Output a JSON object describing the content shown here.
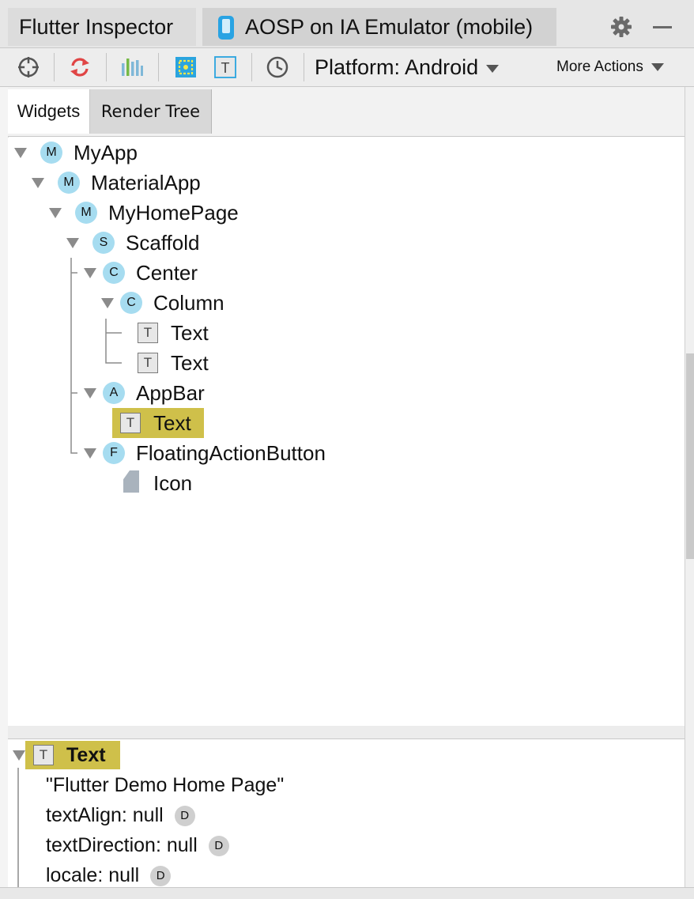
{
  "tabs": {
    "inspector": "Flutter Inspector",
    "emulator": "AOSP on IA Emulator (mobile)"
  },
  "toolbar": {
    "icons": [
      "target-icon",
      "refresh-icon",
      "performance-icon",
      "select-widget-icon",
      "text-icon",
      "clock-icon"
    ],
    "platform": "Platform: Android",
    "more_actions": "More Actions"
  },
  "subtabs": {
    "widgets": "Widgets",
    "render_tree": "Render Tree"
  },
  "tree": {
    "nodes": [
      {
        "label": "MyApp",
        "badge": "M"
      },
      {
        "label": "MaterialApp",
        "badge": "M"
      },
      {
        "label": "MyHomePage",
        "badge": "M"
      },
      {
        "label": "Scaffold",
        "badge": "S"
      },
      {
        "label": "Center",
        "badge": "C"
      },
      {
        "label": "Column",
        "badge": "C"
      },
      {
        "label": "Text",
        "badge": "T"
      },
      {
        "label": "Text",
        "badge": "T"
      },
      {
        "label": "AppBar",
        "badge": "A"
      },
      {
        "label": "Text",
        "badge": "T",
        "selected": true
      },
      {
        "label": "FloatingActionButton",
        "badge": "F"
      },
      {
        "label": "Icon",
        "badge": ""
      }
    ]
  },
  "details": {
    "title": "Text",
    "title_badge": "T",
    "string_value": "\"Flutter Demo Home Page\"",
    "properties": [
      {
        "text": "textAlign: null",
        "badge": "D"
      },
      {
        "text": "textDirection: null",
        "badge": "D"
      },
      {
        "text": "locale: null",
        "badge": "D"
      }
    ]
  },
  "colors": {
    "highlight": "#cfc04a",
    "badge": "#a6dcf0",
    "accent_phone": "#29a3e3"
  }
}
